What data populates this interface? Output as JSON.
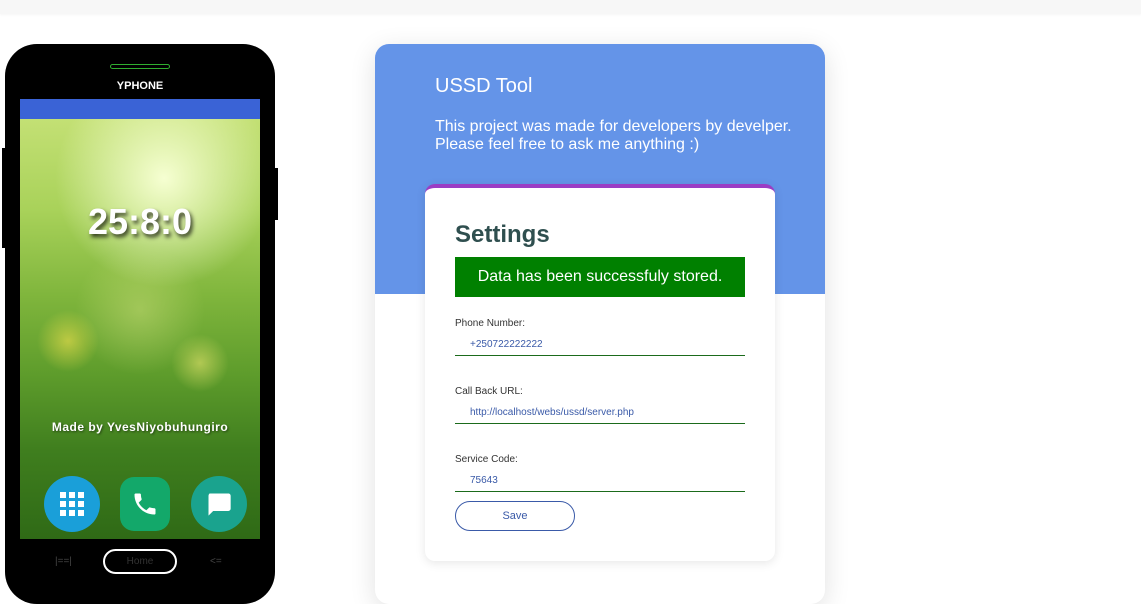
{
  "phone": {
    "brand": "YPHONE",
    "clock": "25:8:0",
    "made_by": "Made by YvesNiyobuhungiro",
    "apps_icon": "apps-grid-icon",
    "phone_icon": "phone-call-icon",
    "message_icon": "message-bubble-icon",
    "nav_back": "|==|",
    "nav_home": "Home",
    "nav_recent": "<=",
    "colors": {
      "statusbar": "#3a63d6",
      "apps": "#1a9fd9",
      "call": "#13a86a",
      "message": "#1aa38e"
    }
  },
  "card": {
    "title": "USSD Tool",
    "description": "This project was made for developers by develper. Please feel free to ask me anything :)",
    "header_color": "#6494e8"
  },
  "settings": {
    "title": "Settings",
    "alert": "Data has been successfuly stored.",
    "alert_color": "#008000",
    "accent_color": "#9b3dc4",
    "fields": [
      {
        "label": "Phone Number:",
        "value": "+250722222222"
      },
      {
        "label": "Call Back URL:",
        "value": "http://localhost/webs/ussd/server.php"
      },
      {
        "label": "Service Code:",
        "value": "75643"
      }
    ],
    "save_label": "Save"
  }
}
